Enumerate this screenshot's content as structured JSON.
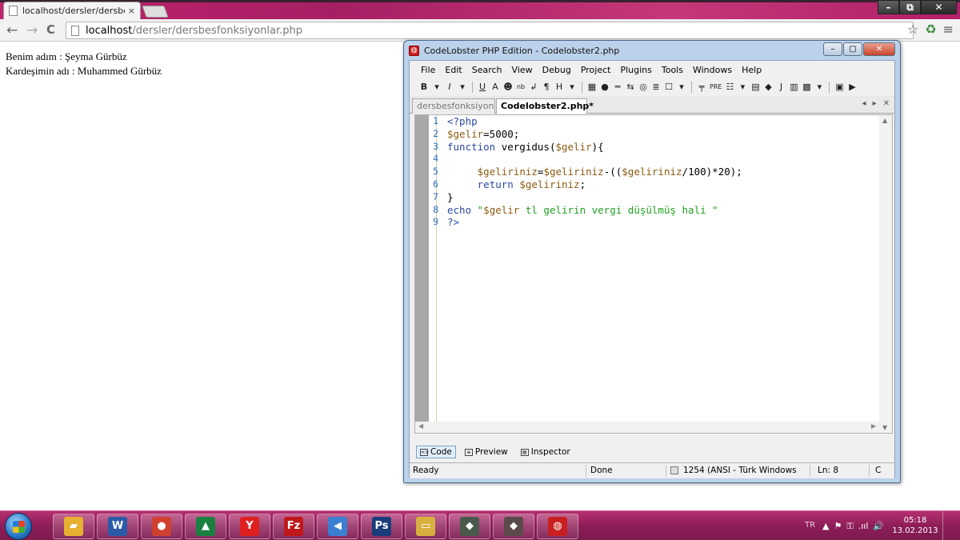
{
  "browser": {
    "tab_title": "localhost/dersler/dersbesf",
    "tab_close": "×",
    "url_host": "localhost",
    "url_path": "/dersler/dersbesfonksiyonlar.php",
    "window_controls": {
      "minimize": "–",
      "maximize": "⧉",
      "close": "✕"
    },
    "nav": {
      "back": "←",
      "forward": "→",
      "reload": "C"
    },
    "icons": {
      "star": "☆",
      "extension": "♻",
      "menu": "≡"
    }
  },
  "page": {
    "lines": [
      "Benim adım : Şeyma Gürbüz",
      "Kardeşimin adı : Muhammed Gürbüz"
    ]
  },
  "ide": {
    "title": "CodeLobster PHP Edition - Codelobster2.php",
    "window_controls": {
      "minimize": "–",
      "maximize": "▢",
      "close": "✕"
    },
    "menu": [
      "File",
      "Edit",
      "Search",
      "View",
      "Debug",
      "Project",
      "Plugins",
      "Tools",
      "Windows",
      "Help"
    ],
    "toolbar": [
      "B",
      "▾",
      "I",
      "▾",
      "U",
      "A",
      "☻",
      "nb",
      "↲",
      "¶",
      "H",
      "▾",
      "▦",
      "●",
      "═",
      "⇆",
      "◎",
      "≣",
      "☐",
      "▾",
      "╤",
      "PRE",
      "☷",
      "▾",
      "▤",
      "◆",
      "J",
      "▥",
      "▩",
      "▾",
      "▣",
      "▶"
    ],
    "tabs": [
      "dersbesfonksiyonl...",
      "Codelobster2.php*"
    ],
    "tab_nav": [
      "◂",
      "▸",
      "✕"
    ],
    "code_lines": [
      {
        "n": "1",
        "parts": [
          {
            "t": "k",
            "s": "<?php"
          }
        ]
      },
      {
        "n": "2",
        "parts": [
          {
            "t": "v",
            "s": "$gelir"
          },
          {
            "t": "p",
            "s": "=5000;"
          }
        ]
      },
      {
        "n": "3",
        "parts": [
          {
            "t": "k",
            "s": "function "
          },
          {
            "t": "p",
            "s": "vergidus("
          },
          {
            "t": "v",
            "s": "$gelir"
          },
          {
            "t": "p",
            "s": "){"
          }
        ]
      },
      {
        "n": "4",
        "parts": [
          {
            "t": "p",
            "s": ""
          }
        ]
      },
      {
        "n": "5",
        "parts": [
          {
            "t": "p",
            "s": "     "
          },
          {
            "t": "v",
            "s": "$geliriniz"
          },
          {
            "t": "p",
            "s": "="
          },
          {
            "t": "v",
            "s": "$geliriniz"
          },
          {
            "t": "p",
            "s": "-(("
          },
          {
            "t": "v",
            "s": "$geliriniz"
          },
          {
            "t": "p",
            "s": "/100)*20);"
          }
        ]
      },
      {
        "n": "6",
        "parts": [
          {
            "t": "p",
            "s": "     "
          },
          {
            "t": "k",
            "s": "return "
          },
          {
            "t": "v",
            "s": "$geliriniz"
          },
          {
            "t": "p",
            "s": ";"
          }
        ]
      },
      {
        "n": "7",
        "parts": [
          {
            "t": "p",
            "s": "}"
          }
        ]
      },
      {
        "n": "8",
        "parts": [
          {
            "t": "k",
            "s": "echo "
          },
          {
            "t": "s",
            "s": "\""
          },
          {
            "t": "v",
            "s": "$gelir"
          },
          {
            "t": "s",
            "s": " tl gelirin vergi düşülmüş hali \""
          }
        ]
      },
      {
        "n": "9",
        "parts": [
          {
            "t": "k",
            "s": "?>"
          }
        ]
      }
    ],
    "view_tabs": [
      "Code",
      "Preview",
      "Inspector"
    ],
    "status": {
      "state": "Ready",
      "progress": "Done",
      "encoding": "1254 (ANSI - Türk Windows",
      "line": "Ln: 8",
      "col": "C"
    }
  },
  "taskbar": {
    "apps": [
      {
        "name": "explorer",
        "glyph": "▰",
        "color": "#e8b030"
      },
      {
        "name": "word",
        "glyph": "W",
        "color": "#2b5aa8"
      },
      {
        "name": "chrome",
        "glyph": "●",
        "color": "#d04030"
      },
      {
        "name": "photos",
        "glyph": "▲",
        "color": "#1a8040"
      },
      {
        "name": "yandex",
        "glyph": "Y",
        "color": "#e02020"
      },
      {
        "name": "filezilla",
        "glyph": "Fz",
        "color": "#c01818"
      },
      {
        "name": "media",
        "glyph": "◀",
        "color": "#3a7fd0"
      },
      {
        "name": "photoshop",
        "glyph": "Ps",
        "color": "#1a3c7a"
      },
      {
        "name": "folder",
        "glyph": "▭",
        "color": "#d8b040"
      },
      {
        "name": "app1",
        "glyph": "◆",
        "color": "#4a5a4a"
      },
      {
        "name": "app2",
        "glyph": "◆",
        "color": "#5a4a4a"
      },
      {
        "name": "codelobster",
        "glyph": "◍",
        "color": "#c82020"
      }
    ],
    "lang": "TR",
    "tray_icons": [
      "▲",
      "⚑",
      "⚿",
      ".ııl",
      "🔊"
    ],
    "time": "05:18",
    "date": "13.02.2013"
  }
}
